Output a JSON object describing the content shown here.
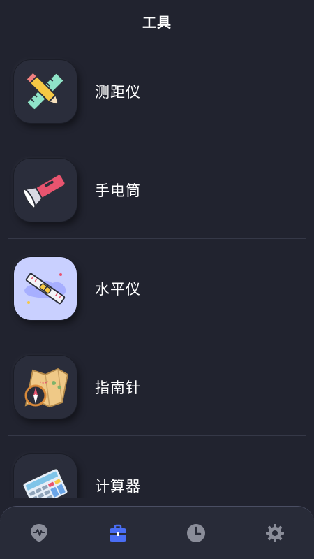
{
  "header": {
    "title": "工具"
  },
  "tools": [
    {
      "label": "测距仪",
      "icon": "ruler-pencil-icon"
    },
    {
      "label": "手电筒",
      "icon": "flashlight-icon"
    },
    {
      "label": "水平仪",
      "icon": "spirit-level-icon"
    },
    {
      "label": "指南针",
      "icon": "compass-map-icon"
    },
    {
      "label": "计算器",
      "icon": "calculator-icon"
    }
  ],
  "bottom_nav": {
    "items": [
      {
        "icon": "heart-rate-pin-icon",
        "active": false
      },
      {
        "icon": "toolbox-icon",
        "active": true
      },
      {
        "icon": "clock-icon",
        "active": false
      },
      {
        "icon": "gear-icon",
        "active": false
      }
    ],
    "active_color": "#4a6ef5",
    "inactive_color": "#8a8d99"
  },
  "colors": {
    "background": "#21232f",
    "card": "#2a2d3b",
    "divider": "#353847"
  }
}
